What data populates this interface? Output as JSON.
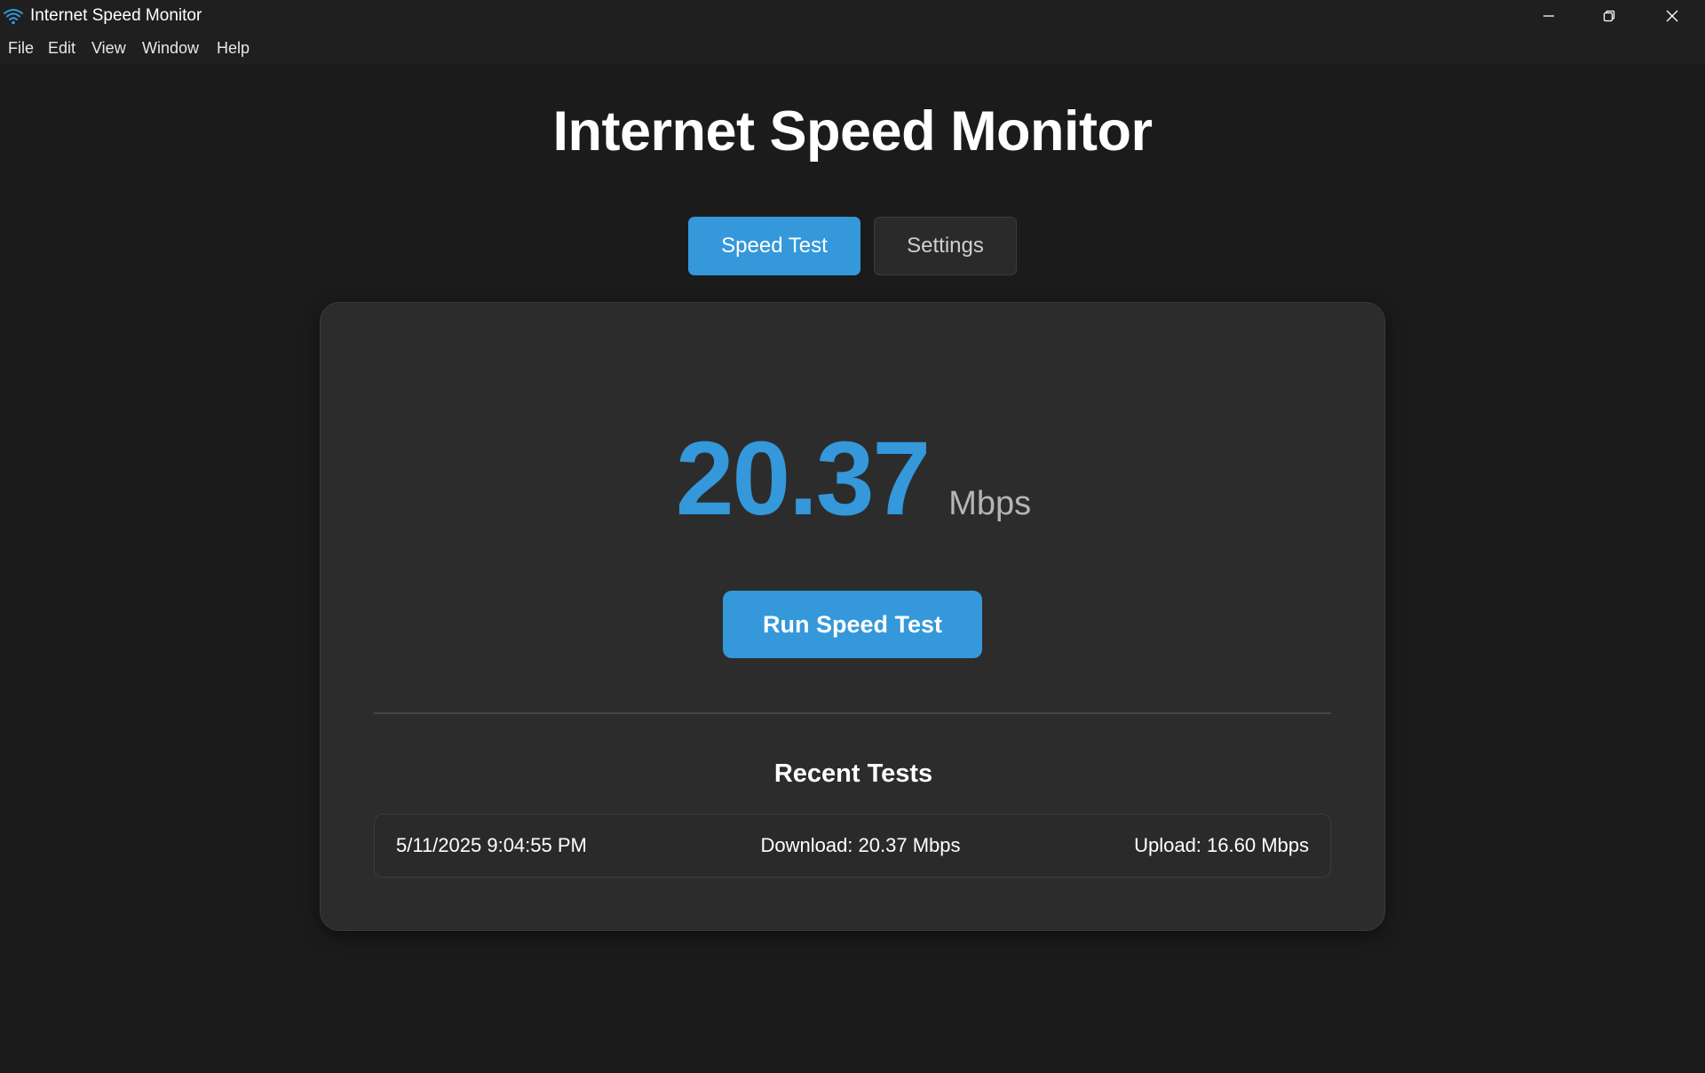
{
  "window": {
    "title": "Internet Speed Monitor",
    "icon": "wifi-icon",
    "controls": [
      "minimize-icon",
      "restore-icon",
      "close-icon"
    ]
  },
  "menu": {
    "items": [
      "File",
      "Edit",
      "View",
      "Window",
      "Help"
    ]
  },
  "main": {
    "title": "Internet Speed Monitor",
    "tabs": [
      {
        "label": "Speed Test",
        "active": true
      },
      {
        "label": "Settings",
        "active": false
      }
    ],
    "speed": {
      "value": "20.37",
      "unit": "Mbps"
    },
    "run_button_label": "Run Speed Test",
    "recent": {
      "title": "Recent Tests",
      "rows": [
        {
          "timestamp": "5/11/2025 9:04:55 PM",
          "download": "Download: 20.37 Mbps",
          "upload": "Upload: 16.60 Mbps"
        }
      ]
    }
  },
  "colors": {
    "accent": "#3498db",
    "background": "#1b1b1b",
    "card": "#2c2c2c"
  }
}
